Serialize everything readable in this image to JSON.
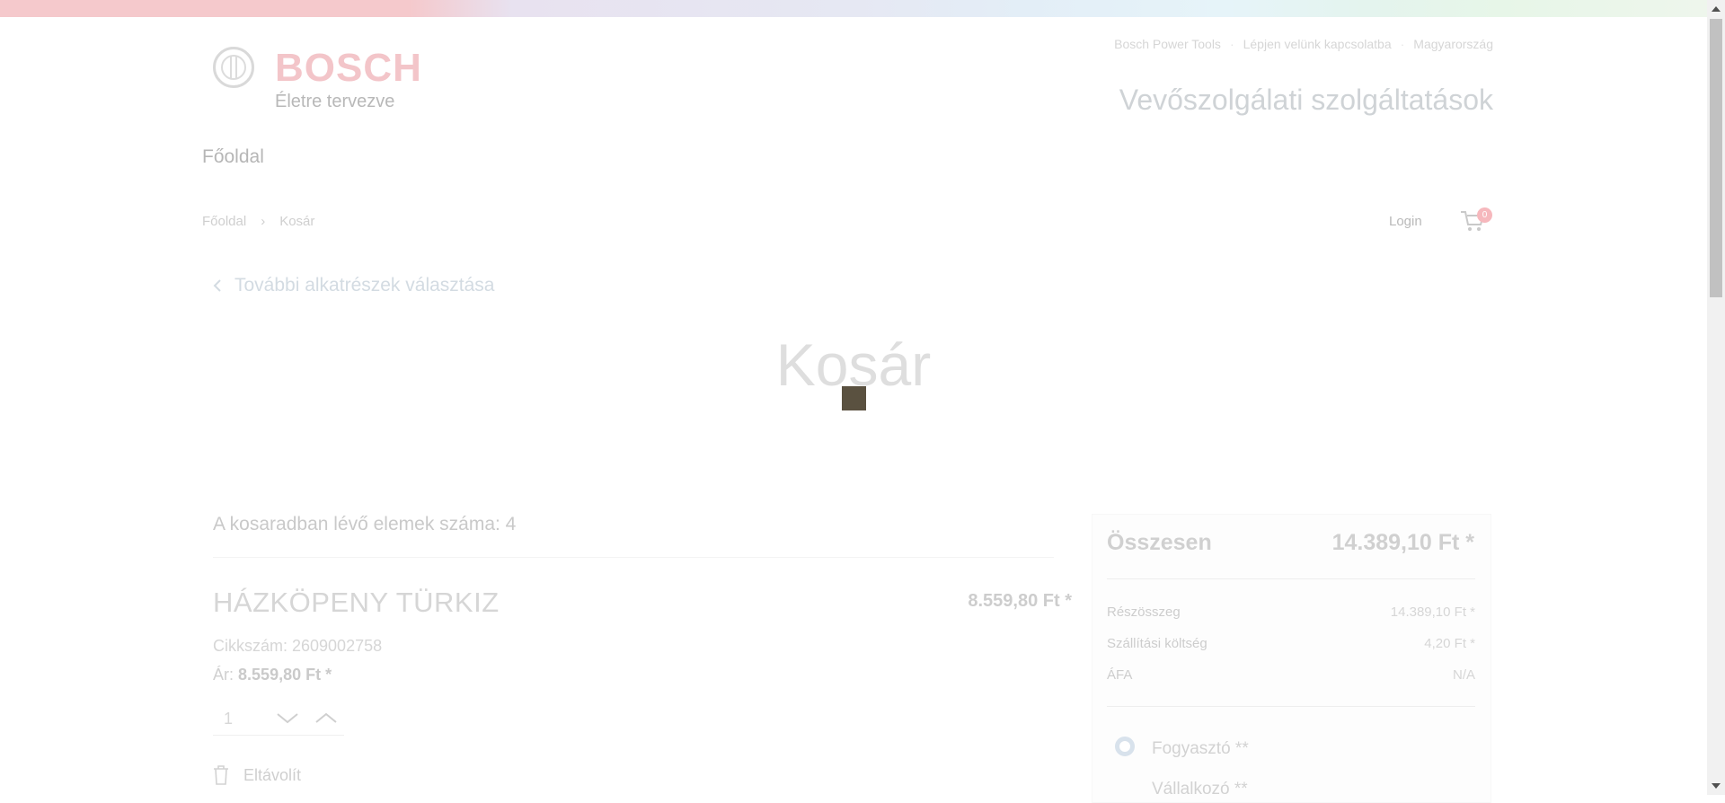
{
  "brand": {
    "name": "BOSCH",
    "tagline": "Életre tervezve",
    "primary_color": "#f3c5c9"
  },
  "top_links": [
    "Bosch Power Tools",
    "Lépjen velünk kapcsolatba",
    "Magyarország"
  ],
  "service_title": "Vevőszolgálati szolgáltatások",
  "nav": {
    "home": "Főoldal"
  },
  "breadcrumb": {
    "home": "Főoldal",
    "separator": "›",
    "current": "Kosár"
  },
  "header_actions": {
    "login": "Login",
    "cart_count": "0",
    "cart_icon": "shopping-cart-icon"
  },
  "back_link": {
    "icon": "chevron-left-icon",
    "label": "További alkatrészek választása"
  },
  "page_title": "Kosár",
  "cart": {
    "items_count_text": "A kosaradban lévő elemek száma: 4",
    "item": {
      "name": "HÁZKÖPENY TÜRKIZ",
      "line_price": "8.559,80  Ft *",
      "sku_text": "Cikkszám: 2609002758",
      "unit_price_label": "Ár:",
      "unit_price_value": "8.559,80  Ft *",
      "quantity": "1",
      "remove_label": "Eltávolít",
      "remove_icon": "trash-icon"
    }
  },
  "summary": {
    "total_label": "Összesen",
    "total_value": "14.389,10  Ft *",
    "rows": [
      {
        "label": "Részösszeg",
        "value": "14.389,10  Ft *"
      },
      {
        "label": "Szállítási költség",
        "value": "4,20  Ft *"
      },
      {
        "label": "ÁFA",
        "value": "N/A"
      }
    ],
    "customer_types": [
      {
        "label": "Fogyasztó **",
        "selected": true
      },
      {
        "label": "Vállalkozó **",
        "selected": false
      }
    ]
  }
}
